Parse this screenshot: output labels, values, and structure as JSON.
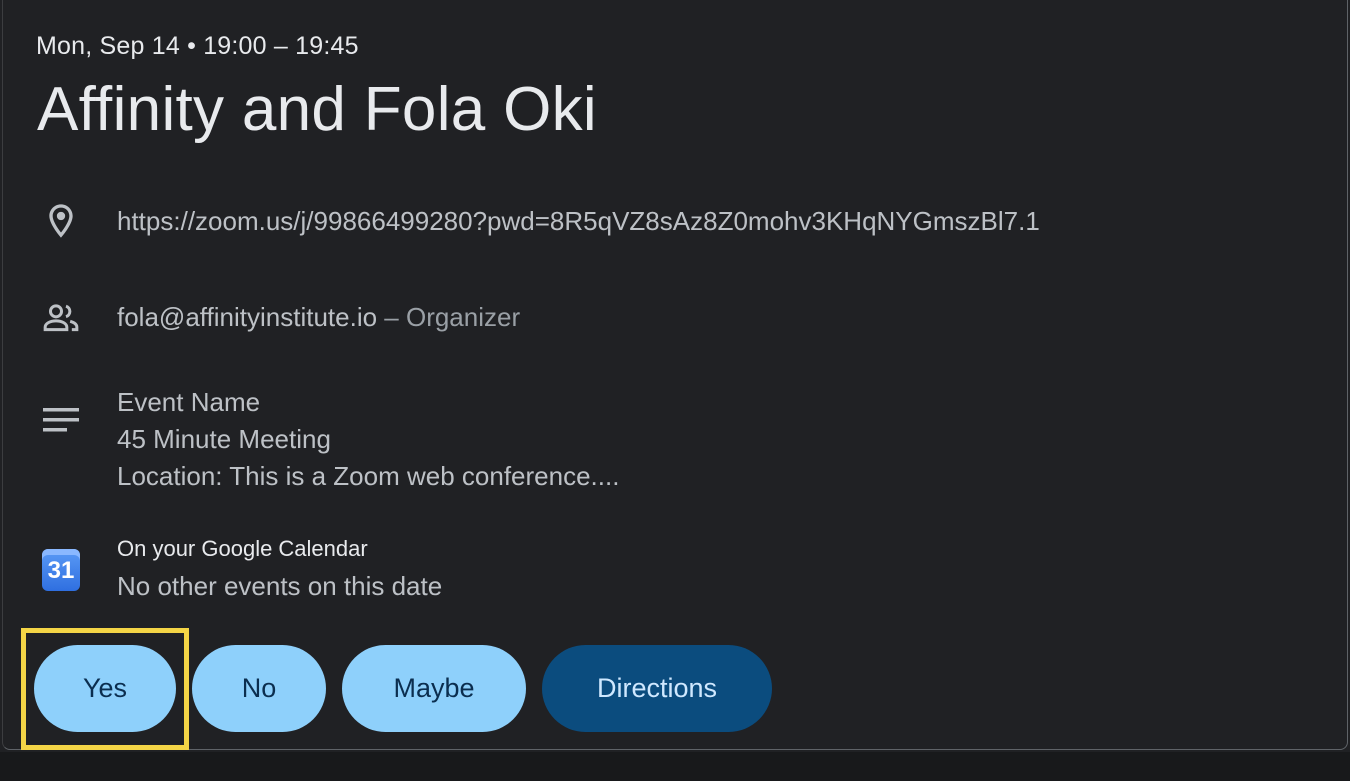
{
  "event": {
    "date_time": "Mon, Sep 14 • 19:00 – 19:45",
    "title": "Affinity and Fola Oki"
  },
  "location": {
    "icon": "location-pin-icon",
    "url": "https://zoom.us/j/99866499280?pwd=8R5qVZ8sAz8Z0mohv3KHqNYGmszBl7.1"
  },
  "organizer": {
    "icon": "people-icon",
    "email": "fola@affinityinstitute.io",
    "role": " – Organizer"
  },
  "description": {
    "icon": "notes-icon",
    "lines": [
      "Event Name",
      "45 Minute Meeting",
      "Location: This is a Zoom web conference...."
    ]
  },
  "calendar": {
    "icon": "google-calendar-icon",
    "icon_day": "31",
    "title": "On your Google Calendar",
    "subtitle": "No other events on this date"
  },
  "actions": {
    "yes": "Yes",
    "no": "No",
    "maybe": "Maybe",
    "directions": "Directions"
  },
  "colors": {
    "background": "#202124",
    "button_light": "#8ed0fb",
    "button_dark": "#0b4c7e",
    "highlight": "#f4d546"
  }
}
